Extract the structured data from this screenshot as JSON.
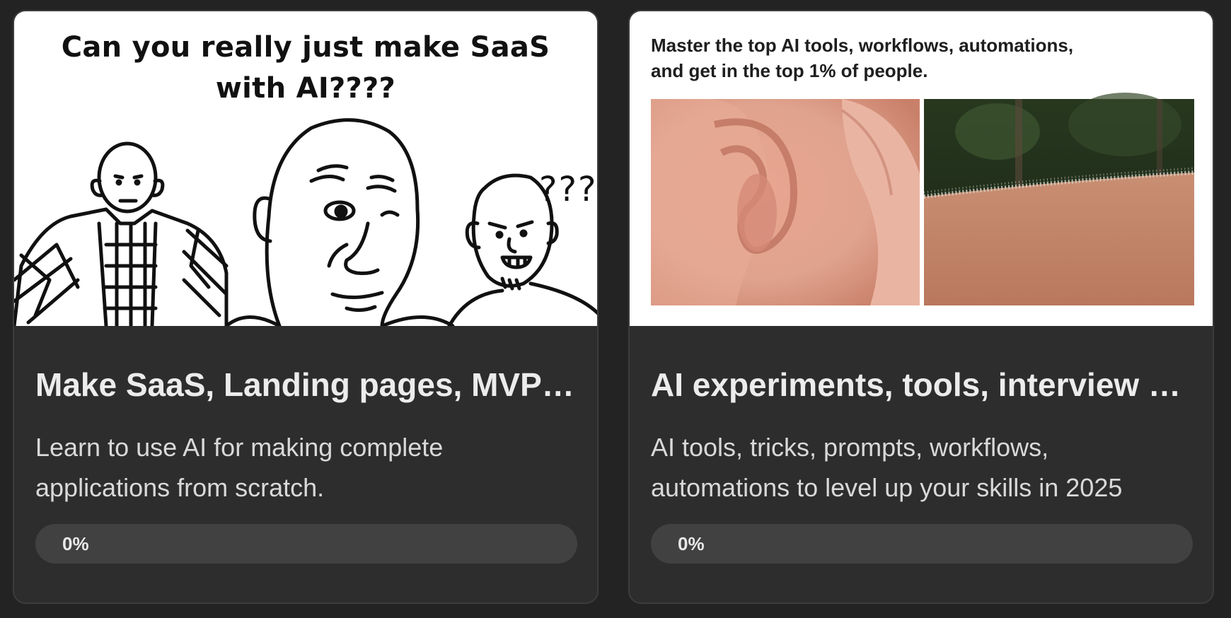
{
  "courses": [
    {
      "thumbnail": {
        "caption_line1": "Can you really just make SaaS",
        "caption_line2": "with AI????",
        "question_marks": "???",
        "icon": "meme-illustration"
      },
      "title": "Make SaaS, Landing pages, MVPs with AI",
      "description": "Learn to use AI for making complete applications from scratch.",
      "progress_percent": 0,
      "progress_label": "0%"
    },
    {
      "thumbnail": {
        "caption_line1": "Master the top AI tools, workflows, automations,",
        "caption_line2": "and get in the top 1% of people.",
        "icon": "ear-and-goosebumps-photo"
      },
      "title": "AI experiments, tools, interview prep",
      "description": "AI tools, tricks, prompts, workflows, automations to level up your skills in 2025",
      "progress_percent": 0,
      "progress_label": "0%"
    }
  ],
  "colors": {
    "background": "#232323",
    "card": "#2d2d2d",
    "progress_track": "#414141",
    "progress_fill": "#5b8def"
  }
}
